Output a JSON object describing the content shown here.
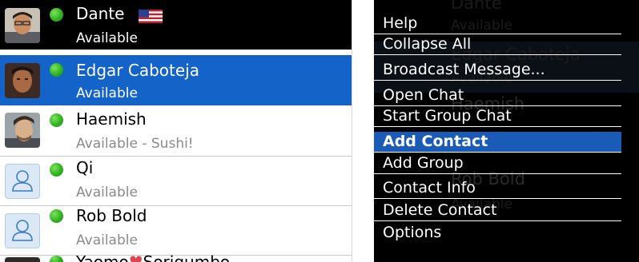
{
  "colors": {
    "selected_row_bg": "#1463c8",
    "header_row_bg": "#000000",
    "presence_available": "#2fb321",
    "menu_selected_bg": "#1a5bb8",
    "secondary_text": "#8a8a8a"
  },
  "contacts": [
    {
      "name": "Dante",
      "status": "Available",
      "flag_icon": "us-flag-icon",
      "avatar": "photo-avatar"
    },
    {
      "name": "Edgar Caboteja",
      "status": "Available",
      "avatar": "photo-avatar",
      "selected": true
    },
    {
      "name": "Haemish",
      "status": "Available - Sushi!",
      "avatar": "photo-avatar"
    },
    {
      "name": "Qi",
      "status": "Available",
      "avatar": "default-person-icon"
    },
    {
      "name": "Rob Bold",
      "status": "Available",
      "avatar": "default-person-icon"
    },
    {
      "name_part1": "Yaomo",
      "name_part2": "Sorigumbo",
      "heart_icon": "heart-icon"
    }
  ],
  "menu": {
    "items": [
      "Help",
      "Collapse All",
      "Broadcast Message...",
      "Open Chat",
      "Start Group Chat",
      "Add Contact",
      "Add Group",
      "Contact Info",
      "Delete Contact",
      "Options"
    ],
    "selected_item": "Add Contact"
  },
  "background_behind_menu": {
    "row1": {
      "name": "Dante",
      "status": "Available"
    },
    "row2": {
      "name": "Edgar Caboteja",
      "status": "Available"
    },
    "row3": {
      "name": "Haemish"
    },
    "row4": {
      "name": "Rob Bold",
      "status": "Available"
    }
  }
}
